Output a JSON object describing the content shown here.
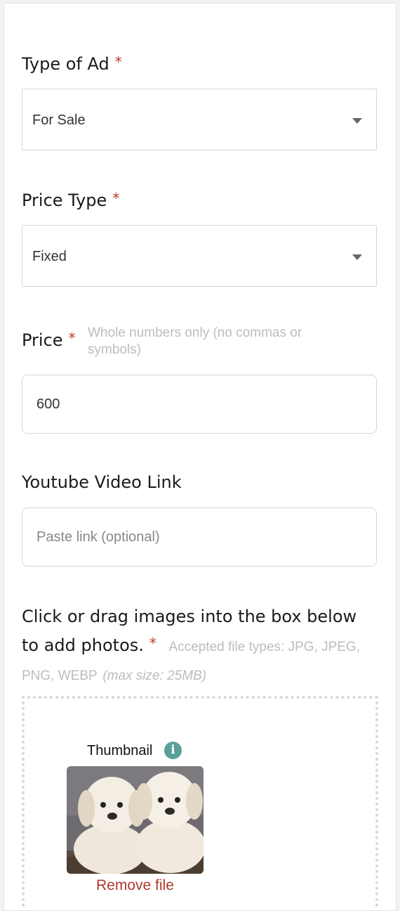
{
  "form": {
    "ad_type": {
      "label": "Type of Ad",
      "required": "*",
      "value": "For Sale"
    },
    "price_type": {
      "label": "Price Type",
      "required": "*",
      "value": "Fixed"
    },
    "price": {
      "label": "Price",
      "required": "*",
      "hint": "Whole numbers only (no commas or symbols)",
      "value": "600"
    },
    "youtube": {
      "label": "Youtube Video Link",
      "placeholder": "Paste link (optional)"
    },
    "photos": {
      "label": "Click or drag images into the box below to add photos.",
      "required": "*",
      "hint": "Accepted file types: JPG, JPEG, PNG, WEBP",
      "hint_italic": "(max size: 25MB)",
      "thumbnail_label": "Thumbnail",
      "remove_label": "Remove file"
    }
  },
  "colors": {
    "required": "#c0392b",
    "info": "#5aa09a",
    "remove": "#b03a2e"
  }
}
